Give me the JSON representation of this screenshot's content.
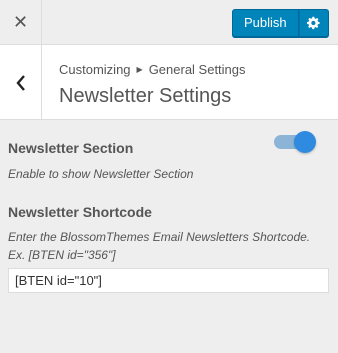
{
  "topbar": {
    "close_icon": "close-icon",
    "publish_label": "Publish",
    "settings_icon": "gear-icon",
    "accent_color": "#0085ba"
  },
  "header": {
    "back_icon": "chevron-left-icon",
    "breadcrumb": [
      "Customizing",
      "General Settings"
    ],
    "title": "Newsletter Settings"
  },
  "controls": {
    "newsletter_section": {
      "title": "Newsletter Section",
      "description": "Enable to show Newsletter Section",
      "enabled": true
    },
    "newsletter_shortcode": {
      "title": "Newsletter Shortcode",
      "description_line1": "Enter the BlossomThemes Email Newsletters Shortcode.",
      "description_line2": "Ex. [BTEN id=\"356\"]",
      "value": "[BTEN id=\"10\"]"
    }
  }
}
